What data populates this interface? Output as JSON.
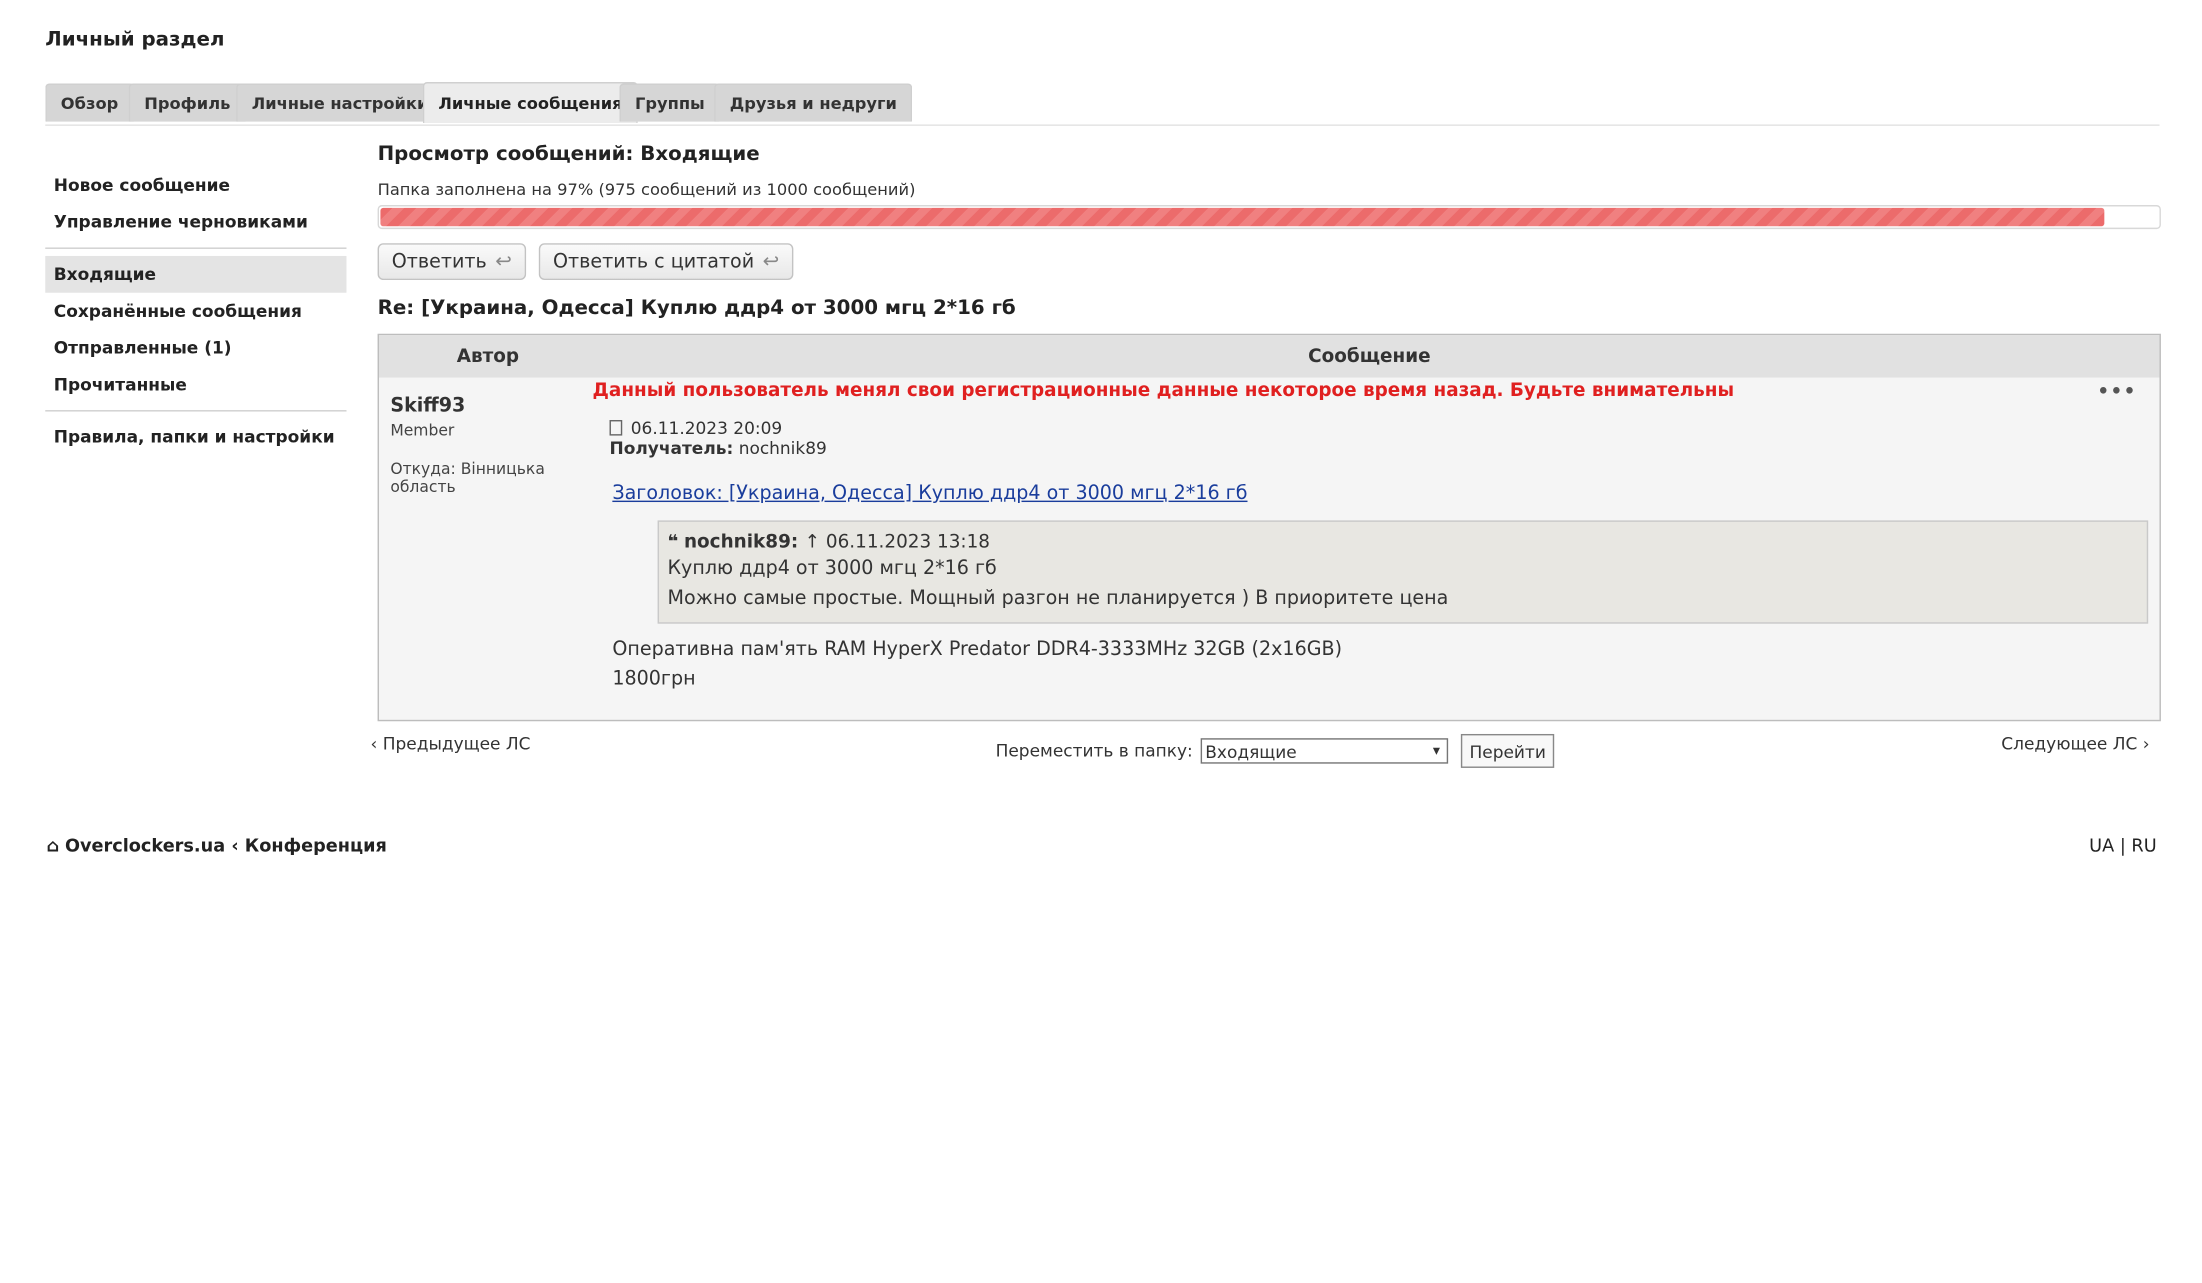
{
  "page_title": "Личный раздел",
  "tabs": [
    {
      "label": "Обзор"
    },
    {
      "label": "Профиль"
    },
    {
      "label": "Личные настройки"
    },
    {
      "label": "Личные сообщения"
    },
    {
      "label": "Группы"
    },
    {
      "label": "Друзья и недруги"
    }
  ],
  "sidebar": {
    "group1": [
      "Новое сообщение",
      "Управление черновиками"
    ],
    "group2": [
      "Входящие",
      "Сохранённые сообщения",
      "Отправленные (1)",
      "Прочитанные"
    ],
    "group3": [
      "Правила, папки и настройки"
    ]
  },
  "main": {
    "title": "Просмотр сообщений: Входящие",
    "quota_text": "Папка заполнена на 97% (975 сообщений из 1000 сообщений)",
    "quota_fraction": 0.97,
    "reply_label": "Ответить",
    "quote_reply_label": "Ответить с цитатой",
    "subject": "Re: [Украина, Одесса] Куплю ддр4 от 3000 мгц 2*16 гб"
  },
  "post": {
    "col_author": "Автор",
    "col_message": "Сообщение",
    "author_name": "Skiff93",
    "author_rank": "Member",
    "author_from_label": "Откуда:",
    "author_from": "Вінницька область",
    "warning": "Данный пользователь менял свои регистрационные данные некоторое время назад. Будьте внимательны",
    "menu": "•••",
    "date": "06.11.2023 20:09",
    "recipient_label": "Получатель:",
    "recipient": "nochnik89",
    "subject_link": "Заголовок: [Украина, Одесса] Куплю ддр4 от 3000 мгц 2*16 гб",
    "quote": {
      "author": "nochnik89:",
      "arrow": "↑",
      "date": "06.11.2023 13:18",
      "lines": [
        "Куплю ддр4 от 3000 мгц 2*16 гб",
        "Можно самые простые. Мощный разгон не планируется ) В приоритете цена"
      ]
    },
    "reply_lines": [
      "Оперативна пам'ять RAM HyperX Predator DDR4-3333MHz 32GB (2x16GB)",
      "1800грн"
    ]
  },
  "pager": {
    "prev": "Предыдущее ЛС",
    "next": "Следующее ЛС",
    "move_label": "Переместить в папку:",
    "folder": "Входящие",
    "go": "Перейти"
  },
  "footer": {
    "site": "Overclockers.ua",
    "section": "Конференция",
    "lang_ua": "UA",
    "lang_sep": "|",
    "lang_ru": "RU"
  }
}
